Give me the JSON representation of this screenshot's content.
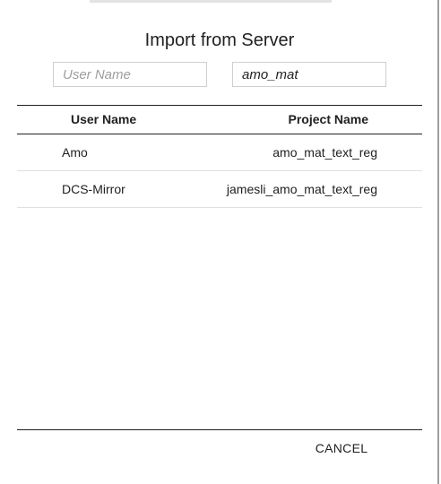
{
  "dialog": {
    "title": "Import from Server"
  },
  "filters": {
    "user_name": {
      "value": "",
      "placeholder": "User Name"
    },
    "project_name": {
      "value": "amo_mat",
      "placeholder": "Project Name"
    }
  },
  "table": {
    "columns": [
      "User Name",
      "Project Name"
    ],
    "rows": [
      {
        "user": "Amo",
        "project": "amo_mat_text_reg"
      },
      {
        "user": "DCS-Mirror",
        "project": "jamesli_amo_mat_text_reg"
      }
    ]
  },
  "footer": {
    "cancel_label": "CANCEL"
  }
}
